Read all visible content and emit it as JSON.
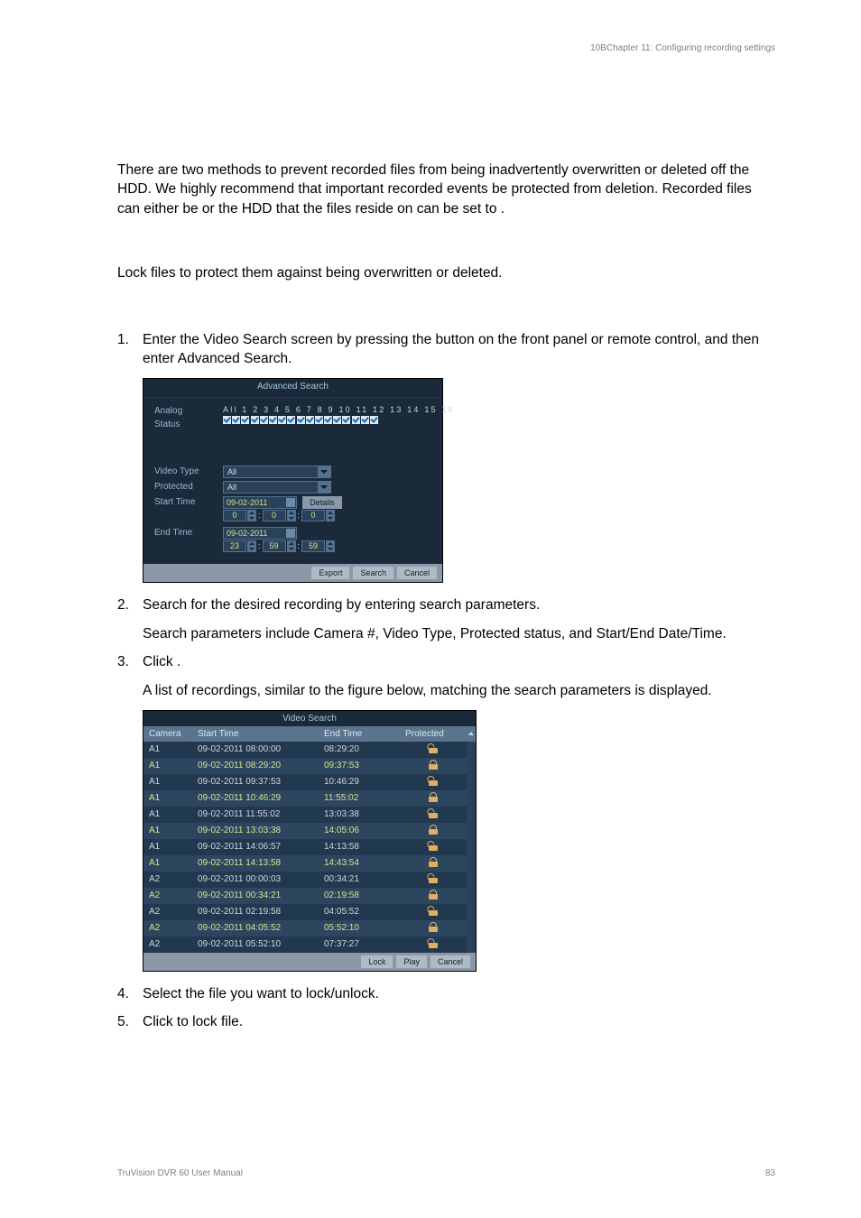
{
  "header": "10BChapter 11: Configuring recording settings",
  "intro_para": "There are two methods to prevent recorded files from being inadvertently overwritten or deleted off the HDD. We highly recommend that important recorded events be protected from deletion. Recorded files can either be or the HDD that the files reside on can be set to              .",
  "section_heading": "",
  "lockfiles_intro": "Lock files to protect them against being overwritten or deleted.",
  "sub_heading": "",
  "step1": "Enter the Video Search screen by pressing the              button on the front panel or remote control, and then enter Advanced Search.",
  "adv": {
    "title": "Advanced Search",
    "analog_label": "Analog",
    "status_label": "Status",
    "all_label": "All",
    "video_type": "Video Type",
    "protected": "Protected",
    "start_time": "Start Time",
    "end_time": "End Time",
    "all": "All",
    "date1": "09-02-2011",
    "date2": "09-02-2011",
    "t_start": [
      "0",
      "0",
      "0"
    ],
    "t_end": [
      "23",
      "59",
      "59"
    ],
    "details": "Details",
    "export": "Export",
    "search": "Search",
    "cancel": "Cancel"
  },
  "step2": "Search for the desired recording by entering search parameters.",
  "step2_sub": "Search parameters include Camera #, Video Type, Protected status, and Start/End Date/Time.",
  "step3": "Click            .",
  "step3_sub": "A list of recordings, similar to the figure below, matching the search parameters is displayed.",
  "video": {
    "title": "Video Search",
    "cols": [
      "Camera",
      "Start Time",
      "End Time",
      "Protected"
    ],
    "rows": [
      {
        "c": "A1",
        "s": "09-02-2011 08:00:00",
        "e": "08:29:20",
        "lock": "unlocked"
      },
      {
        "c": "A1",
        "s": "09-02-2011 08:29:20",
        "e": "09:37:53",
        "lock": "locked",
        "hl": true
      },
      {
        "c": "A1",
        "s": "09-02-2011 09:37:53",
        "e": "10:46:29",
        "lock": "unlocked"
      },
      {
        "c": "A1",
        "s": "09-02-2011 10:46:29",
        "e": "11:55:02",
        "lock": "locked",
        "hl": true
      },
      {
        "c": "A1",
        "s": "09-02-2011 11:55:02",
        "e": "13:03:38",
        "lock": "unlocked"
      },
      {
        "c": "A1",
        "s": "09-02-2011 13:03:38",
        "e": "14:05:06",
        "lock": "locked",
        "hl": true
      },
      {
        "c": "A1",
        "s": "09-02-2011 14:06:57",
        "e": "14:13:58",
        "lock": "unlocked"
      },
      {
        "c": "A1",
        "s": "09-02-2011 14:13:58",
        "e": "14:43:54",
        "lock": "locked",
        "hl": true
      },
      {
        "c": "A2",
        "s": "09-02-2011 00:00:03",
        "e": "00:34:21",
        "lock": "unlocked"
      },
      {
        "c": "A2",
        "s": "09-02-2011 00:34:21",
        "e": "02:19:58",
        "lock": "locked",
        "hl": true
      },
      {
        "c": "A2",
        "s": "09-02-2011 02:19:58",
        "e": "04:05:52",
        "lock": "unlocked"
      },
      {
        "c": "A2",
        "s": "09-02-2011 04:05:52",
        "e": "05:52:10",
        "lock": "locked",
        "hl": true
      },
      {
        "c": "A2",
        "s": "09-02-2011 05:52:10",
        "e": "07:37:27",
        "lock": "unlocked"
      }
    ],
    "lock_btn": "Lock",
    "play_btn": "Play",
    "cancel_btn": "Cancel"
  },
  "step4": "Select the file you want to lock/unlock.",
  "step5": "Click          to lock file.",
  "footer_left": "TruVision DVR 60 User Manual",
  "footer_right": "83"
}
